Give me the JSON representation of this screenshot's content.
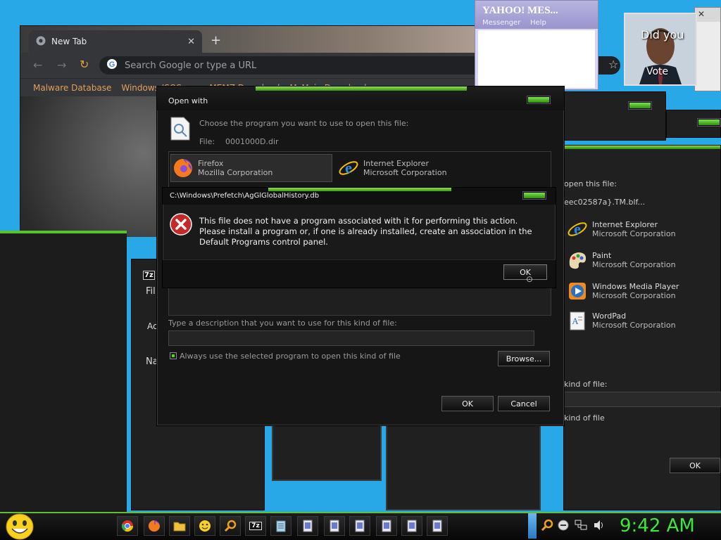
{
  "browser": {
    "tab_title": "New Tab",
    "omnibox_placeholder": "Search Google or type a URL",
    "bookmarks": [
      "Malware Database",
      "Windows ISOS",
      "...",
      "MEMZ Download",
      "McMain Download"
    ]
  },
  "yahoo": {
    "title": "YAHOO! MES...",
    "menu": [
      "Messenger",
      "Help"
    ]
  },
  "obama": {
    "caption_top": "Did you",
    "caption_bottom": "Vote"
  },
  "open_with": {
    "title": "Open with",
    "instruction": "Choose the program you want to use to open this file:",
    "file_label": "File:",
    "file_name": "0001000D.dir",
    "programs": [
      {
        "name": "Firefox",
        "company": "Mozilla Corporation"
      },
      {
        "name": "Internet Explorer",
        "company": "Microsoft Corporation"
      }
    ],
    "description_label": "Type a description that you want to use for this kind of file:",
    "always_use_label": "Always use the selected program to open this kind of file",
    "browse_label": "Browse...",
    "ok_label": "OK",
    "cancel_label": "Cancel"
  },
  "error": {
    "title": "C:\\Windows\\Prefetch\\AgGlGlobalHistory.db",
    "message": "This file does not have a program associated with it for performing this action. Please install a program or, if one is already installed, create an association in the Default Programs control panel.",
    "ok_label": "OK"
  },
  "right_window": {
    "instruction_partial": "open this file:",
    "file_partial": "eec02587a}.TM.blf...",
    "programs": [
      {
        "name": "Internet Explorer",
        "company": "Microsoft Corporation"
      },
      {
        "name": "Paint",
        "company": "Microsoft Corporation"
      },
      {
        "name": "Windows Media Player",
        "company": "Microsoft Corporation"
      },
      {
        "name": "WordPad",
        "company": "Microsoft Corporation"
      }
    ],
    "kind_label_1": "kind of file:",
    "kind_label_2": "kind of file",
    "ok_label": "OK"
  },
  "left_partial": {
    "menu_letter": "Fil",
    "label_a": "Ac",
    "label_n": "Na",
    "seven_zip": "7z"
  },
  "taskbar": {
    "clock": "9:42 AM",
    "buttons": [
      "chrome-icon",
      "firefox-icon",
      "folder-icon",
      "smiley-icon",
      "search-icon",
      "7zip-icon",
      "notepad-icon",
      "doc-icon",
      "doc-icon",
      "doc-icon",
      "doc-icon",
      "doc-icon",
      "doc-icon"
    ]
  },
  "colors": {
    "accent_green": "#5bd12e",
    "clock_green": "#39e839",
    "desktop_blue": "#29a8e8"
  }
}
